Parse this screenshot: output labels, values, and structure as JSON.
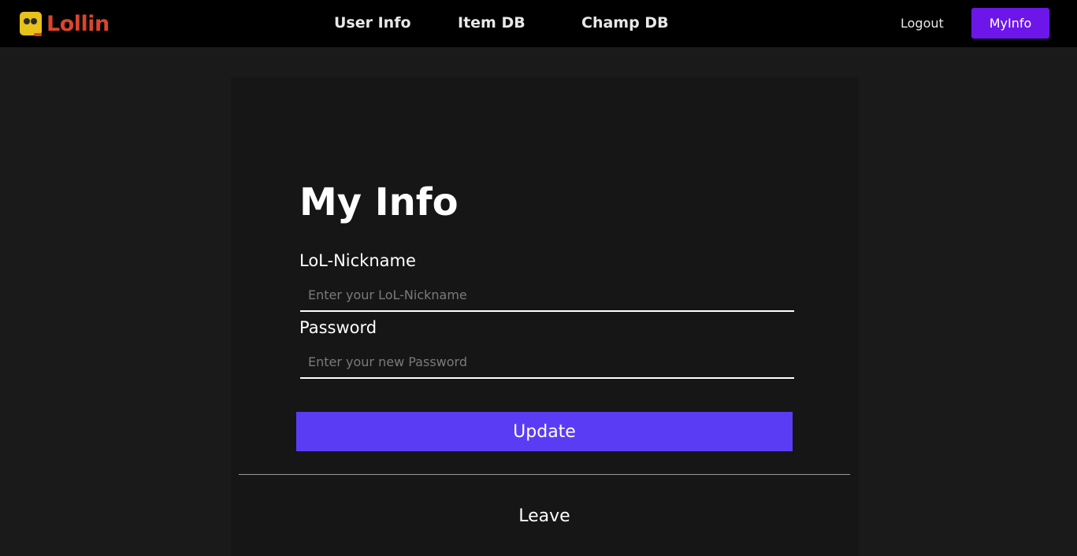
{
  "navbar": {
    "logo_text": "Lollin",
    "links": [
      "User Info",
      "Item DB",
      "Champ DB"
    ],
    "logout_label": "Logout",
    "myinfo_label": "MyInfo"
  },
  "form": {
    "title": "My Info",
    "nickname_label": "LoL-Nickname",
    "nickname_placeholder": "Enter your LoL-Nickname",
    "password_label": "Password",
    "password_placeholder": "Enter your new Password",
    "update_label": "Update",
    "leave_label": "Leave"
  },
  "colors": {
    "accent": "#6c16e9",
    "update_button": "#5b3cf5",
    "logo_red": "#d9452b",
    "logo_yellow": "#e6c21a"
  }
}
